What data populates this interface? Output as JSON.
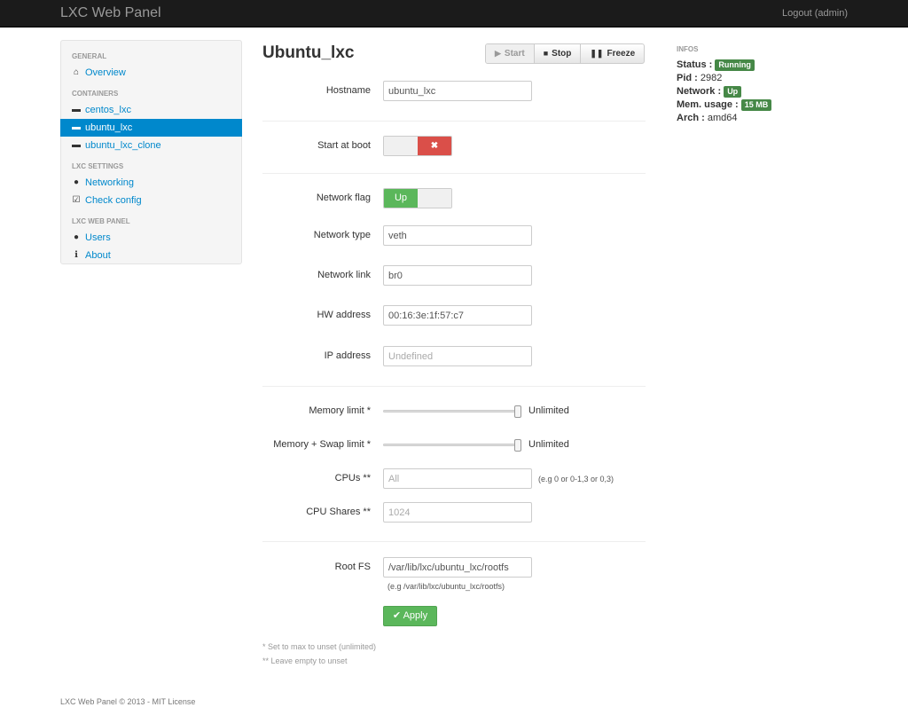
{
  "navbar": {
    "brand": "LXC Web Panel",
    "logout": "Logout (admin)"
  },
  "sidebar": {
    "general_header": "GENERAL",
    "overview": "Overview",
    "containers_header": "CONTAINERS",
    "containers": [
      "centos_lxc",
      "ubuntu_lxc",
      "ubuntu_lxc_clone"
    ],
    "lxc_settings_header": "LXC SETTINGS",
    "networking": "Networking",
    "check_config": "Check config",
    "lxc_web_panel_header": "LXC WEB PANEL",
    "users": "Users",
    "about": "About"
  },
  "page": {
    "title": "Ubuntu_lxc"
  },
  "actions": {
    "start": "Start",
    "stop": "Stop",
    "freeze": "Freeze"
  },
  "form": {
    "hostname_label": "Hostname",
    "hostname_value": "ubuntu_lxc",
    "start_at_boot_label": "Start at boot",
    "start_at_boot_toggle": "✖",
    "network_flag_label": "Network flag",
    "network_flag_toggle": "Up",
    "network_type_label": "Network type",
    "network_type_value": "veth",
    "network_link_label": "Network link",
    "network_link_value": "br0",
    "hw_address_label": "HW address",
    "hw_address_value": "00:16:3e:1f:57:c7",
    "ip_address_label": "IP address",
    "ip_address_placeholder": "Undefined",
    "memory_limit_label": "Memory limit *",
    "memory_limit_value": "Unlimited",
    "memory_swap_label": "Memory + Swap limit *",
    "memory_swap_value": "Unlimited",
    "cpus_label": "CPUs **",
    "cpus_placeholder": "All",
    "cpus_help": "(e.g 0 or 0-1,3 or 0,3)",
    "cpu_shares_label": "CPU Shares **",
    "cpu_shares_placeholder": "1024",
    "rootfs_label": "Root FS",
    "rootfs_value": "/var/lib/lxc/ubuntu_lxc/rootfs",
    "rootfs_help": "(e.g /var/lib/lxc/ubuntu_lxc/rootfs)",
    "apply_label": "Apply",
    "note_unset": "* Set to max to unset (unlimited)",
    "note_empty": "** Leave empty to unset"
  },
  "infos": {
    "title": "INFOS",
    "status_label": "Status :",
    "status_value": "Running",
    "pid_label": "Pid :",
    "pid_value": "2982",
    "network_label": "Network :",
    "network_value": "Up",
    "mem_label": "Mem. usage :",
    "mem_value": "15 MB",
    "arch_label": "Arch :",
    "arch_value": "amd64"
  },
  "footer": "LXC Web Panel © 2013 - MIT License",
  "colors": {
    "navbar": "#1b1b1b",
    "accent": "#0088cc",
    "success": "#5bb75b",
    "danger": "#da4f49",
    "badge": "#468847"
  }
}
